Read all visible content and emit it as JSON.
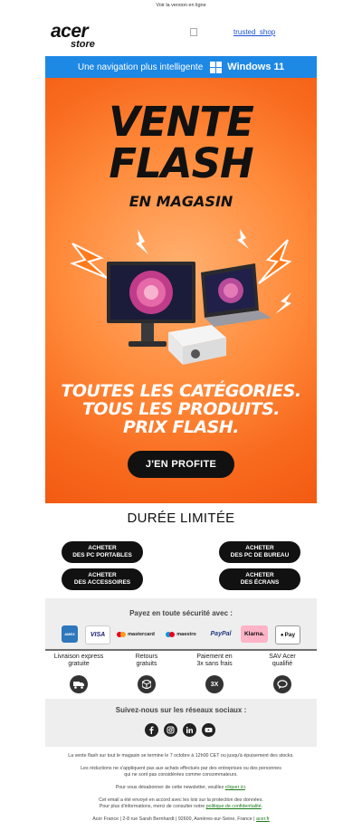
{
  "topline": "Voir la version en ligne",
  "logo": {
    "brand": "acer",
    "sub": "store"
  },
  "trusted": {
    "alt": "trusted_shop"
  },
  "winbar": {
    "text": "Une navigation plus intelligente",
    "brand": "Windows 11"
  },
  "hero": {
    "line1": "VENTE",
    "line2": "FLASH",
    "line3": "EN MAGASIN",
    "tag1": "TOUTES LES CATÉGORIES.",
    "tag2": "TOUS LES PRODUITS.",
    "tag3": "PRIX FLASH.",
    "cta": "J'EN PROFITE"
  },
  "duree": "DURÉE LIMITÉE",
  "categories": [
    {
      "l1": "ACHETER",
      "l2": "DES PC PORTABLES"
    },
    {
      "l1": "ACHETER",
      "l2": "DES PC DE BUREAU"
    },
    {
      "l1": "ACHETER",
      "l2": "DES ACCESSOIRES"
    },
    {
      "l1": "ACHETER",
      "l2": "DES ÉCRANS"
    }
  ],
  "payment": {
    "title": "Payez en toute sécurité avec :",
    "cards": [
      "AMEX",
      "VISA",
      "mastercard",
      "maestro",
      "PayPal",
      "Klarna.",
      "Pay"
    ]
  },
  "features": [
    {
      "l1": "Livraison express",
      "l2": "gratuite",
      "icon": "truck-icon"
    },
    {
      "l1": "Retours",
      "l2": "gratuits",
      "icon": "box-icon"
    },
    {
      "l1": "Paiement en",
      "l2": "3x sans frais",
      "icon": "3x-icon",
      "badge": "3X"
    },
    {
      "l1": "SAV Acer",
      "l2": "qualifié",
      "icon": "chat-icon"
    }
  ],
  "social": {
    "title": "Suivez-nous sur les réseaux sociaux :",
    "networks": [
      "facebook-icon",
      "instagram-icon",
      "linkedin-icon",
      "youtube-icon"
    ]
  },
  "footer": {
    "p1": "La vente flash sur tout le magasin se termine le 7 octobre à 12h00 CET ou jusqu'à épuisement des stocks.",
    "p2a": "Les réductions ne s'appliquent pas aux achats effectués par des entreprises ou des personnes",
    "p2b": "qui ne sont pas considérées comme consommateurs.",
    "p3": "Pour vous désabonner de cette newsletter, veuillez",
    "p3link": "cliquer ici",
    "p4a": "Cet email a été envoyé en accord avec les lois sur la protection des données.",
    "p4b": "Pour plus d'informations, merci de consulter notre",
    "p4link": "politique de confidentialité",
    "p5": "Acer France  |  2-8 rue Sarah Bernhardt  |  92600, Asnières-sur-Seine, France  |",
    "p5link": "acer.fr"
  },
  "colors": {
    "winbar": "#1e88e5",
    "hero": "#f86a1e",
    "button": "#111111",
    "panel": "#eeeeee"
  }
}
